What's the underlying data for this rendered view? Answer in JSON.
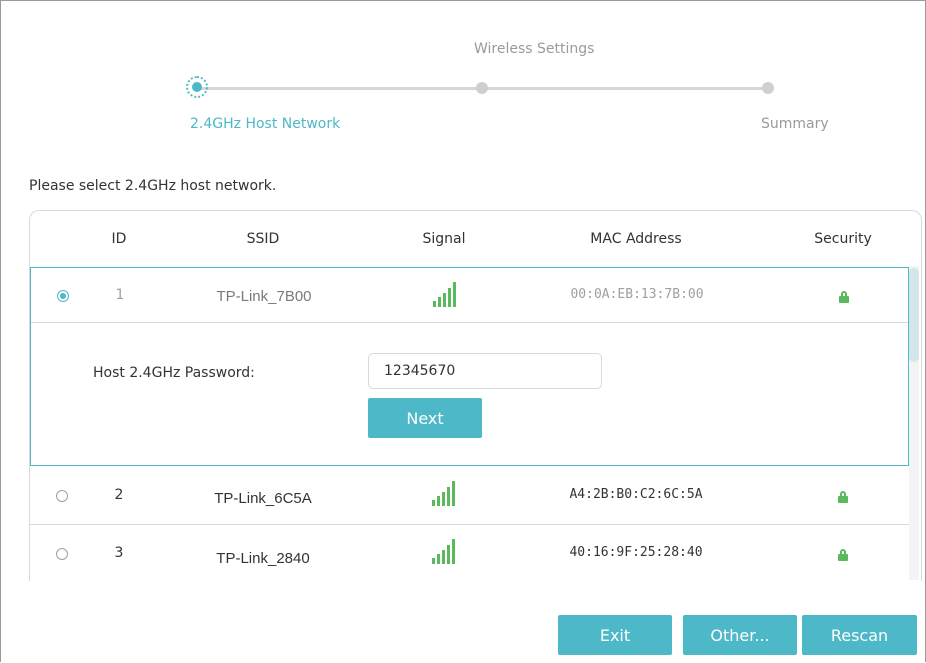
{
  "stepper": {
    "top_label": "Wireless Settings",
    "step1_label": "2.4GHz Host Network",
    "step3_label": "Summary"
  },
  "instruction": "Please select 2.4GHz host network.",
  "table": {
    "headers": [
      "ID",
      "SSID",
      "Signal",
      "MAC Address",
      "Security"
    ],
    "rows": [
      {
        "id": "1",
        "ssid": "TP-Link_7B00",
        "mac": "00:0A:EB:13:7B:00",
        "selected": true,
        "signal_icon": "signal-bars-icon",
        "security_icon": "lock-icon"
      },
      {
        "id": "2",
        "ssid": "TP-Link_6C5A",
        "mac": "A4:2B:B0:C2:6C:5A",
        "selected": false,
        "signal_icon": "signal-bars-icon",
        "security_icon": "lock-icon"
      },
      {
        "id": "3",
        "ssid": "TP-Link_2840",
        "mac": "40:16:9F:25:28:40",
        "selected": false,
        "signal_icon": "signal-bars-icon",
        "security_icon": "lock-icon"
      }
    ],
    "password_label": "Host 2.4GHz Password:",
    "password_value": "12345670",
    "next_label": "Next"
  },
  "buttons": {
    "exit": "Exit",
    "other": "Other...",
    "rescan": "Rescan"
  },
  "colors": {
    "accent": "#4db8c7",
    "signal": "#5cb85c"
  }
}
